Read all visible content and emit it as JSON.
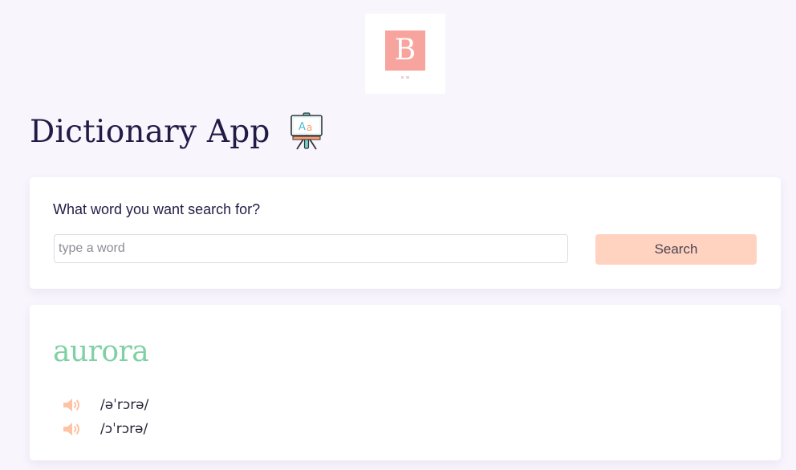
{
  "logo": {
    "letter": "B"
  },
  "header": {
    "title": "Dictionary App",
    "icon": "easel-icon"
  },
  "search": {
    "question": "What word you want search for?",
    "placeholder": "type a word",
    "value": "",
    "button_label": "Search"
  },
  "result": {
    "word": "aurora",
    "phonetics": [
      {
        "text": "/əˈrɔrə/",
        "icon": "speaker-icon"
      },
      {
        "text": "/ɔˈrɔrə/",
        "icon": "speaker-icon"
      }
    ]
  },
  "colors": {
    "background": "#f8f5fd",
    "logo_accent": "#f8a49e",
    "title_text": "#231b45",
    "search_button": "#ffd3bf",
    "result_word": "#7fd1a4",
    "speaker_icon": "#ffc2a4"
  }
}
